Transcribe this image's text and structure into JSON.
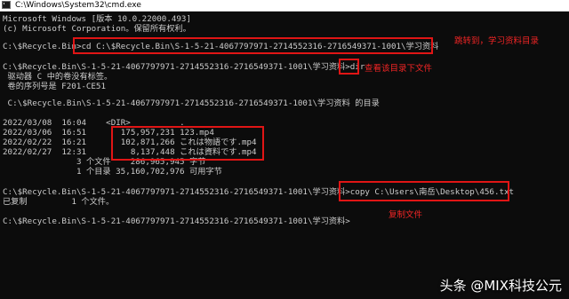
{
  "window": {
    "title": "C:\\Windows\\System32\\cmd.exe",
    "icon": "cmd-icon"
  },
  "console": {
    "lines": [
      "Microsoft Windows [版本 10.0.22000.493]",
      "(c) Microsoft Corporation。保留所有权利。",
      "",
      "C:\\$Recycle.Bin>cd C:\\$Recycle.Bin\\S-1-5-21-4067797971-2714552316-2716549371-1001\\学习资料",
      "",
      "C:\\$Recycle.Bin\\S-1-5-21-4067797971-2714552316-2716549371-1001\\学习资料>dir",
      " 驱动器 C 中的卷没有标签。",
      " 卷的序列号是 F201-CE51",
      "",
      " C:\\$Recycle.Bin\\S-1-5-21-4067797971-2714552316-2716549371-1001\\学习资料 的目录",
      "",
      "2022/03/08  16:04    <DIR>          .",
      "2022/03/06  16:51       175,957,231 123.mp4",
      "2022/02/22  16:21       102,871,266 これは物語です.mp4",
      "2022/02/27  12:31         8,137,448 これは資料です.mp4",
      "               3 个文件    286,965,945 字节",
      "               1 个目录 35,160,702,976 可用字节",
      "",
      "C:\\$Recycle.Bin\\S-1-5-21-4067797971-2714552316-2716549371-1001\\学习资料>copy C:\\Users\\南岳\\Desktop\\456.txt",
      "已复制         1 个文件。",
      "",
      "C:\\$Recycle.Bin\\S-1-5-21-4067797971-2714552316-2716549371-1001\\学习资料>"
    ]
  },
  "annotations": {
    "cd_note": "跳转到，学习资料目录",
    "dir_note": "查看该目录下文件",
    "copy_note": "复制文件",
    "highlight_color": "#e01515"
  },
  "watermark": "头条 @MIX科技公元"
}
